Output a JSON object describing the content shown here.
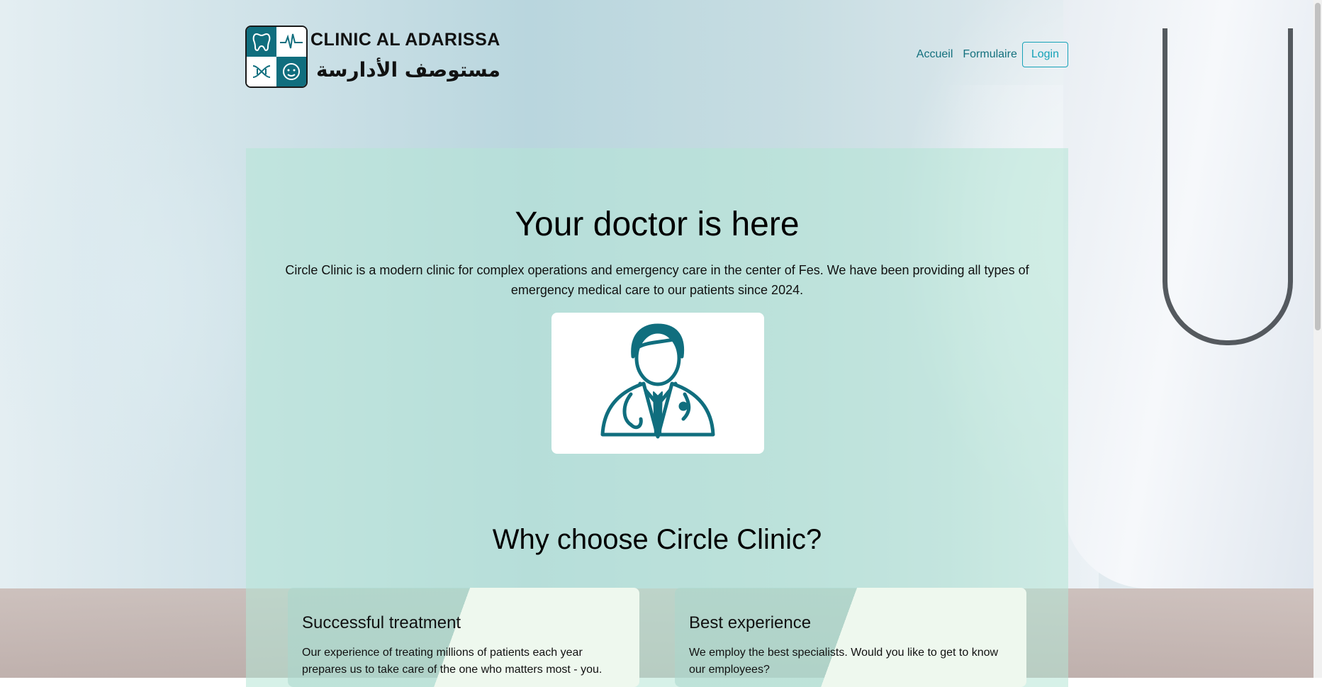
{
  "header": {
    "logo_title": "CLINIC AL ADARISSA",
    "logo_arabic": "مستوصف الأدارسة",
    "nav": {
      "accueil": "Accueil",
      "formulaire": "Formulaire",
      "login": "Login"
    }
  },
  "hero": {
    "title": "Your doctor is here",
    "description": "Circle Clinic is a modern clinic for complex operations and emergency care in the center of Fes. We have been providing all types of emergency medical care to our patients since 2024."
  },
  "why": {
    "title": "Why choose Circle Clinic?",
    "cards": [
      {
        "title": "Successful treatment",
        "text": "Our experience of treating millions of patients each year prepares us to take care of the one who matters most - you."
      },
      {
        "title": "Best experience",
        "text": "We employ the best specialists. Would you like to get to know our employees?"
      }
    ]
  },
  "colors": {
    "brand": "#106e7e",
    "login_outline": "#16a2b8",
    "panel": "#b4e6d6"
  }
}
